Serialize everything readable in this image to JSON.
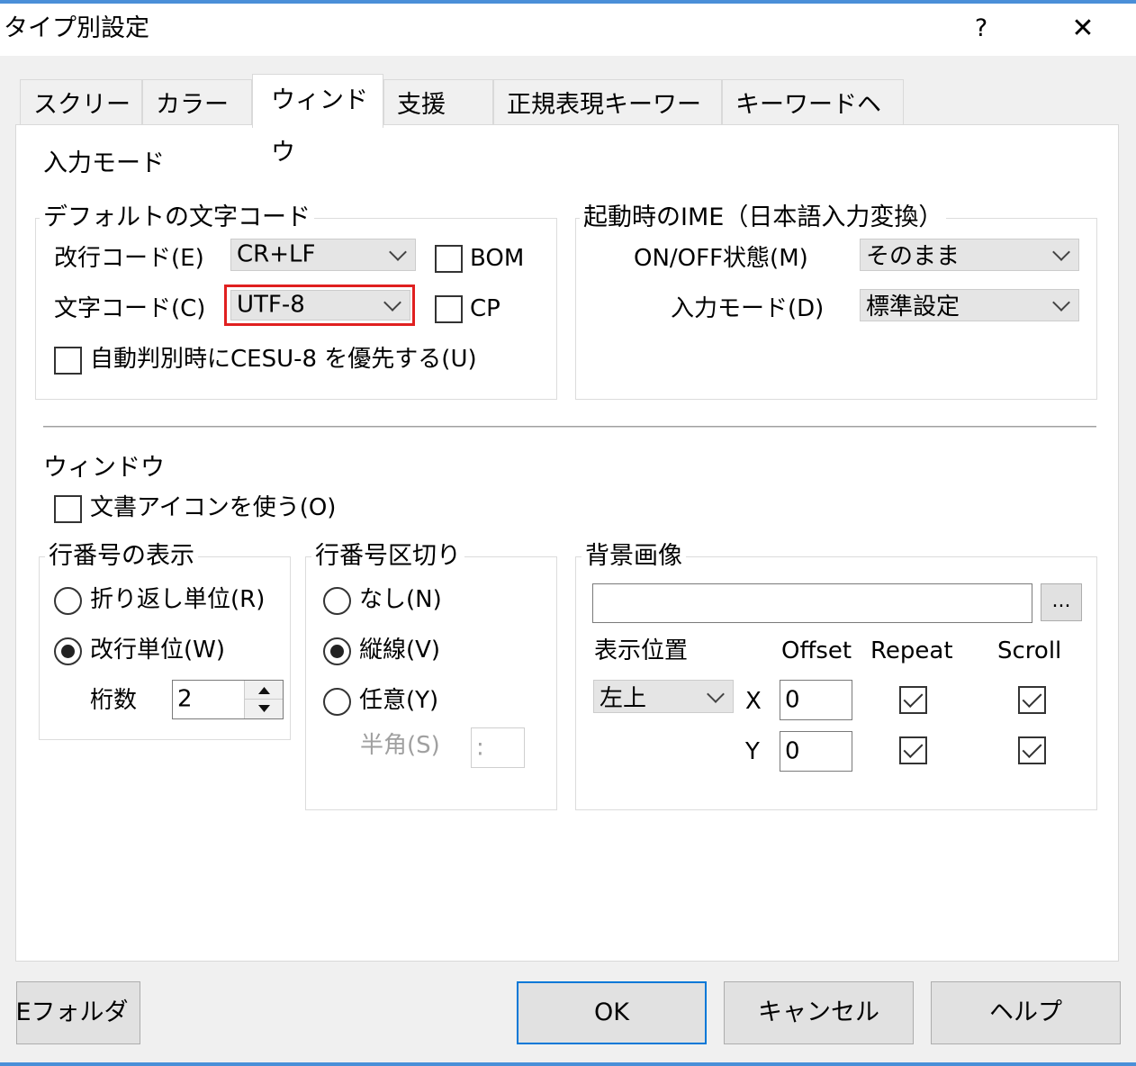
{
  "window": {
    "title": "タイプ別設定",
    "help_label": "?",
    "close_label": "✕"
  },
  "tabs": [
    {
      "label": "スクリーン"
    },
    {
      "label": "カラー"
    },
    {
      "label": "ウィンドウ",
      "active": true
    },
    {
      "label": "支援"
    },
    {
      "label": "正規表現キーワード"
    },
    {
      "label": "キーワードヘルプ"
    }
  ],
  "input_mode": {
    "heading": "入力モード",
    "default_charset": {
      "label": "デフォルトの文字コード",
      "eol_label": "改行コード(E)",
      "eol_value": "CR+LF",
      "bom_label": "BOM",
      "bom_checked": false,
      "charset_label": "文字コード(C)",
      "charset_value": "UTF-8",
      "cp_label": "CP",
      "cp_checked": false,
      "cesu_label": "自動判別時にCESU-8 を優先する(U)",
      "cesu_checked": false
    },
    "ime": {
      "label": "起動時のIME（日本語入力変換）",
      "onoff_label": "ON/OFF状態(M)",
      "onoff_value": "そのまま",
      "mode_label": "入力モード(D)",
      "mode_value": "標準設定"
    }
  },
  "window_section": {
    "heading": "ウィンドウ",
    "doc_icon_label": "文書アイコンを使う(O)",
    "doc_icon_checked": false,
    "line_num_display": {
      "label": "行番号の表示",
      "opt_wrap": "折り返し単位(R)",
      "opt_newline": "改行単位(W)",
      "selected": "newline",
      "digits_label": "桁数",
      "digits_value": "2"
    },
    "line_num_separator": {
      "label": "行番号区切り",
      "opt_none": "なし(N)",
      "opt_vline": "縦線(V)",
      "opt_any": "任意(Y)",
      "selected": "vline",
      "halfwidth_label": "半角(S)",
      "halfwidth_value": ":"
    },
    "background": {
      "label": "背景画像",
      "path_value": "",
      "browse_label": "...",
      "position_label": "表示位置",
      "position_value": "左上",
      "offset_header": "Offset",
      "repeat_header": "Repeat",
      "scroll_header": "Scroll",
      "x_label": "X",
      "x_value": "0",
      "y_label": "Y",
      "y_value": "0",
      "repeat_x": true,
      "scroll_x": true,
      "repeat_y": true,
      "scroll_y": true
    }
  },
  "footer": {
    "folder_button": "Eフォルダ(/)",
    "ok": "OK",
    "cancel": "キャンセル",
    "help": "ヘルプ"
  },
  "colors": {
    "accent": "#0078d7",
    "highlight": "#e02020",
    "dialog_bg": "#f0f0f0"
  }
}
